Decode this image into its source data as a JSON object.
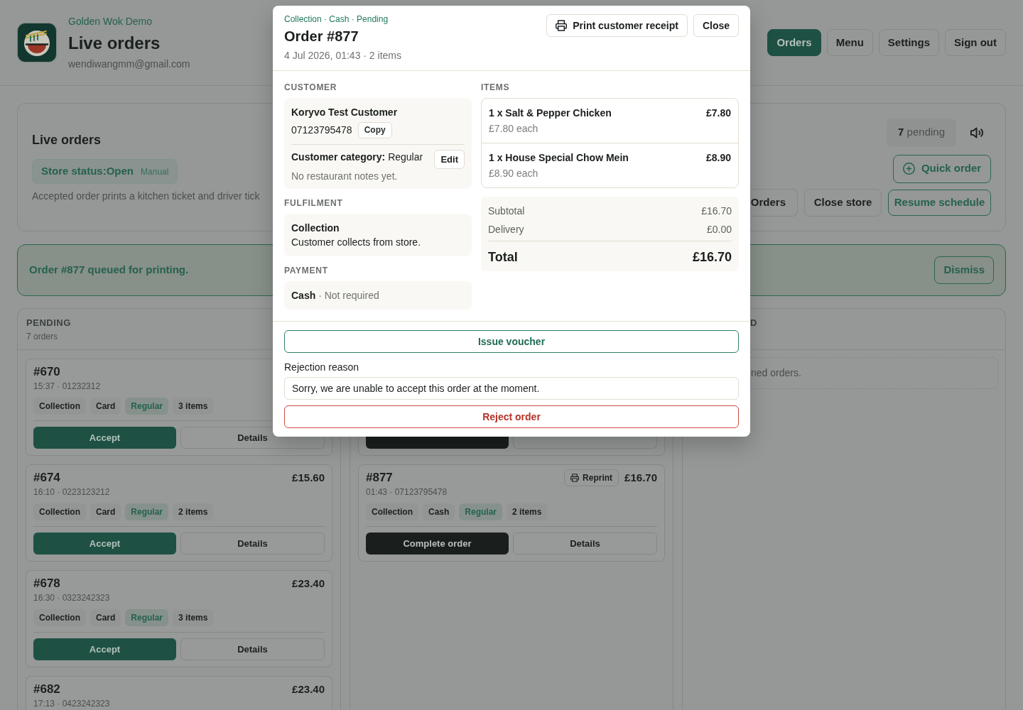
{
  "header": {
    "brand": "Golden Wok Demo",
    "title": "Live orders",
    "email": "wendiwangmm@gmail.com",
    "nav": [
      {
        "label": "Orders",
        "selected": true
      },
      {
        "label": "Menu",
        "selected": false
      },
      {
        "label": "Settings",
        "selected": false
      },
      {
        "label": "Sign out",
        "selected": false
      }
    ]
  },
  "store_panel": {
    "title": "Live orders",
    "store_status": "Store status:Open",
    "status_mode": "Manual",
    "note": "Accepted order prints a kitchen ticket and driver tick",
    "pending": {
      "count": "7",
      "label": "pending"
    },
    "quick_order": "Quick order",
    "buttons": [
      {
        "label": "Orders",
        "kind": "partial"
      },
      {
        "label": "Close store",
        "kind": "plain"
      },
      {
        "label": "Resume schedule",
        "kind": "outline"
      }
    ]
  },
  "banner": {
    "message": "Order #877 queued for printing.",
    "action": "Dismiss"
  },
  "columns": [
    {
      "kind": "full",
      "title": "PENDING",
      "subtitle": "7 orders",
      "orders": [
        {
          "kind": "full",
          "number": "#670",
          "meta": "15:37 · 01232312",
          "chips": [
            {
              "label": "Collection",
              "kind": "plain"
            },
            {
              "label": "Card",
              "kind": "plain"
            },
            {
              "label": "Regular",
              "kind": "category"
            },
            {
              "label": "3 items",
              "kind": "plain"
            }
          ],
          "actions": [
            {
              "label": "Accept",
              "kind": "accept"
            },
            {
              "label": "Details",
              "kind": "details"
            }
          ]
        },
        {
          "kind": "full",
          "number": "#674",
          "price": "£15.60",
          "meta": "16:10 · 0223123212",
          "chips": [
            {
              "label": "Collection",
              "kind": "plain"
            },
            {
              "label": "Card",
              "kind": "plain"
            },
            {
              "label": "Regular",
              "kind": "category"
            },
            {
              "label": "2 items",
              "kind": "plain"
            }
          ],
          "actions": [
            {
              "label": "Accept",
              "kind": "accept"
            },
            {
              "label": "Details",
              "kind": "details"
            }
          ]
        },
        {
          "kind": "full",
          "number": "#678",
          "price": "£23.40",
          "meta": "16:30 · 0323242323",
          "chips": [
            {
              "label": "Collection",
              "kind": "plain"
            },
            {
              "label": "Card",
              "kind": "plain"
            },
            {
              "label": "Regular",
              "kind": "category"
            },
            {
              "label": "3 items",
              "kind": "plain"
            }
          ],
          "actions": [
            {
              "label": "Accept",
              "kind": "accept"
            },
            {
              "label": "Details",
              "kind": "details"
            }
          ]
        },
        {
          "kind": "cut",
          "number": "#682",
          "price": "£23.40",
          "meta": "17:13 · 0423242323"
        }
      ]
    },
    {
      "kind": "covered",
      "orders": [
        {
          "kind": "partial",
          "actions": [
            {
              "kind": "complete"
            },
            {
              "kind": "details"
            }
          ]
        },
        {
          "kind": "full",
          "number": "#877",
          "reprint": "Reprint",
          "price": "£16.70",
          "meta": "01:43 · 07123795478",
          "chips": [
            {
              "label": "Collection",
              "kind": "plain"
            },
            {
              "label": "Cash",
              "kind": "plain"
            },
            {
              "label": "Regular",
              "kind": "category"
            },
            {
              "label": "2 items",
              "kind": "plain"
            }
          ],
          "actions": [
            {
              "label": "Complete order",
              "kind": "complete"
            },
            {
              "label": "Details",
              "kind": "details"
            }
          ]
        }
      ]
    },
    {
      "kind": "covered_left",
      "title": "D",
      "empty_text": "ned orders."
    }
  ],
  "modal": {
    "tags": "Collection · Cash · Pending",
    "title": "Order #877",
    "subtitle": "4 Jul 2026, 01:43 · 2 items",
    "print_button": "Print customer receipt",
    "close_button": "Close",
    "customer": {
      "heading": "CUSTOMER",
      "name": "Koryvo Test Customer",
      "phone": "07123795478",
      "copy": "Copy",
      "category": "**Customer category:** Regular",
      "edit": "Edit",
      "notes": "No restaurant notes yet."
    },
    "fulfilment": {
      "heading": "FULFILMENT",
      "method": "Collection",
      "detail": "Customer collects from store."
    },
    "payment": {
      "heading": "PAYMENT",
      "method": "Cash",
      "detail": "· Not required"
    },
    "items": {
      "heading": "ITEMS",
      "rows": [
        {
          "name": "1 x Salt & Pepper Chicken",
          "price": "£7.80",
          "unit": "£7.80 each"
        },
        {
          "name": "1 x House Special Chow Mein",
          "price": "£8.90",
          "unit": "£8.90 each"
        }
      ]
    },
    "totals": [
      {
        "label": "Subtotal",
        "value": "£16.70",
        "kind": "line"
      },
      {
        "label": "Delivery",
        "value": "£0.00",
        "kind": "line"
      },
      {
        "label": "Total",
        "value": "£16.70",
        "kind": "total"
      }
    ],
    "voucher_button": "Issue voucher",
    "rejection": {
      "label": "Rejection reason",
      "value": "Sorry, we are unable to accept this order at the moment.",
      "button": "Reject order"
    }
  }
}
